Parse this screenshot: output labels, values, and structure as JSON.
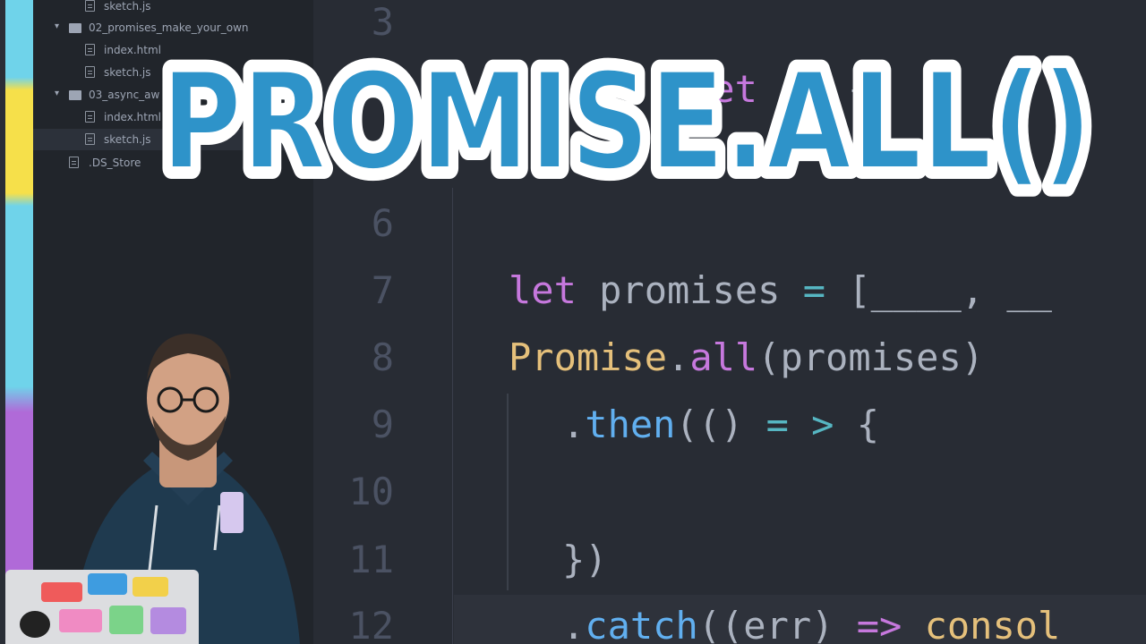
{
  "title": {
    "text": "PROMISE.ALL()"
  },
  "sidebar": {
    "items": [
      {
        "label": "sketch.js",
        "type": "file",
        "depth": 2,
        "selected": false
      },
      {
        "label": "02_promises_make_your_own",
        "type": "folder",
        "depth": 1,
        "expanded": true
      },
      {
        "label": "index.html",
        "type": "file",
        "depth": 2,
        "selected": false
      },
      {
        "label": "sketch.js",
        "type": "file",
        "depth": 2,
        "selected": false
      },
      {
        "label": "03_async_aw",
        "type": "folder",
        "depth": 1,
        "expanded": true
      },
      {
        "label": "index.html",
        "type": "file",
        "depth": 2,
        "selected": false
      },
      {
        "label": "sketch.js",
        "type": "file",
        "depth": 2,
        "selected": true
      },
      {
        "label": ".DS_Store",
        "type": "file",
        "depth": 1,
        "selected": false
      }
    ]
  },
  "editor": {
    "line_numbers": [
      "3",
      "6",
      "7",
      "8",
      "9",
      "10",
      "11",
      "12"
    ],
    "lines": {
      "l3": "",
      "l7": {
        "kw": "let",
        "rest": " promises ",
        "op": "=",
        "tail": " [____, __"
      },
      "l8": {
        "cls": "Promise",
        "dot": ".",
        "fn": "all",
        "rest": "(promises)"
      },
      "l9": {
        "dot": ".",
        "fn": "then",
        "p1": "(() ",
        "op": "= >",
        "tail": " {"
      },
      "l11": {
        "text": "})"
      },
      "l12": {
        "dot": ".",
        "fn": "catch",
        "p1": "((err) ",
        "op": "=>",
        "tail": " consol"
      }
    },
    "obscured_fragment": {
      "kw": "let",
      "brace": "{"
    }
  },
  "colors": {
    "banner_fill": "#2e93c9",
    "banner_outline": "#ffffff",
    "keyword": "#c678dd",
    "class": "#e5c07b",
    "function": "#61afef",
    "operator": "#56b6c2"
  }
}
